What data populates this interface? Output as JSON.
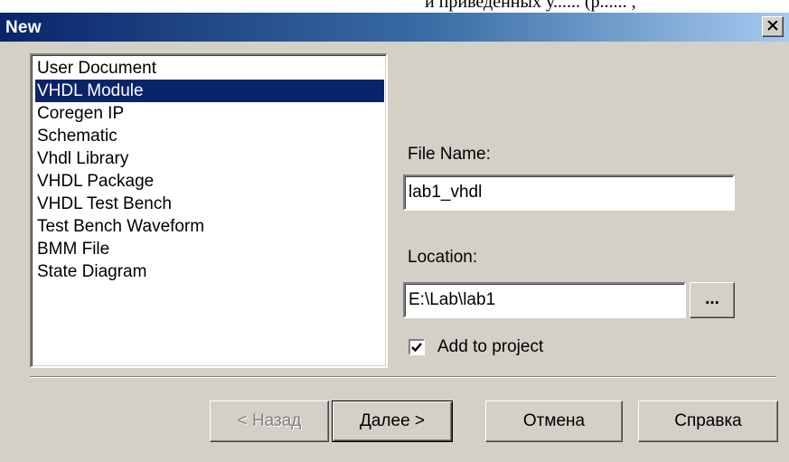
{
  "window": {
    "title": "New"
  },
  "background_text": "и приведенных у...... (р...... ,",
  "file_types": {
    "items": [
      {
        "label": "User Document",
        "selected": false
      },
      {
        "label": "VHDL Module",
        "selected": true
      },
      {
        "label": "Coregen IP",
        "selected": false
      },
      {
        "label": "Schematic",
        "selected": false
      },
      {
        "label": "Vhdl Library",
        "selected": false
      },
      {
        "label": "VHDL Package",
        "selected": false
      },
      {
        "label": "VHDL Test Bench",
        "selected": false
      },
      {
        "label": "Test Bench Waveform",
        "selected": false
      },
      {
        "label": "BMM File",
        "selected": false
      },
      {
        "label": "State Diagram",
        "selected": false
      }
    ]
  },
  "file_name": {
    "label": "File Name:",
    "value": "lab1_vhdl"
  },
  "location": {
    "label": "Location:",
    "value": "E:\\Lab\\lab1",
    "browse_label": "..."
  },
  "add_to_project": {
    "label": "Add to project",
    "checked": true
  },
  "buttons": {
    "back": "< Назад",
    "next": "Далее >",
    "cancel": "Отмена",
    "help": "Справка"
  }
}
